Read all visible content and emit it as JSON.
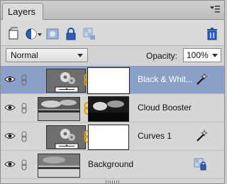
{
  "panel": {
    "tab_label": "Layers"
  },
  "toolbar": {
    "icons": [
      "new-layer-icon",
      "adjustment-layer-icon",
      "layer-mask-icon",
      "lock-all-icon",
      "lock-transparency-icon",
      "delete-layer-icon"
    ]
  },
  "blend": {
    "mode": "Normal",
    "opacity_label": "Opacity:",
    "opacity_value": "100%"
  },
  "layers": [
    {
      "name": "Black & Whit...",
      "selected": true,
      "visible": true,
      "kind": "adjustment"
    },
    {
      "name": "Cloud Booster",
      "selected": false,
      "visible": true,
      "kind": "image-with-mask"
    },
    {
      "name": "Curves 1",
      "selected": false,
      "visible": true,
      "kind": "adjustment"
    },
    {
      "name": "Background",
      "selected": false,
      "visible": true,
      "kind": "background-locked"
    }
  ],
  "colors": {
    "selection": "#8aa0c7",
    "chain": "#e0a000",
    "delete": "#2a5ec9"
  }
}
